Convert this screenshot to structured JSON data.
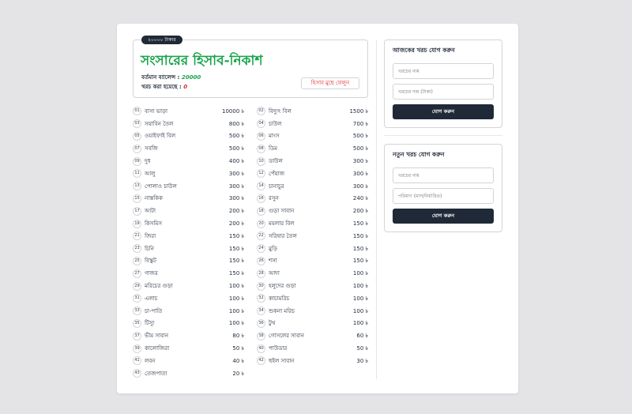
{
  "budget_pill": "২০০০০ টাকার",
  "title": "সংসারের হিসাব-নিকাশ",
  "current_balance_label": "বর্তমান ব্যালেন্স : ",
  "current_balance_value": "20000",
  "spent_label": "খরচ করা হয়েছে : ",
  "spent_value": "0",
  "clear_button": "হিসাব মুছে ফেলুন",
  "items": [
    {
      "no": "01",
      "name": "বাসা ভাড়া",
      "amount": "10000 ৳"
    },
    {
      "no": "02",
      "name": "বিদ্যুৎ বিল",
      "amount": "1500 ৳"
    },
    {
      "no": "03",
      "name": "সয়াবিন তৈল",
      "amount": "800 ৳"
    },
    {
      "no": "04",
      "name": "চাউল",
      "amount": "700 ৳"
    },
    {
      "no": "05",
      "name": "ওয়াইফাই বিল",
      "amount": "500 ৳"
    },
    {
      "no": "06",
      "name": "মাংস",
      "amount": "500 ৳"
    },
    {
      "no": "07",
      "name": "সবজি",
      "amount": "500 ৳"
    },
    {
      "no": "08",
      "name": "ডিম",
      "amount": "500 ৳"
    },
    {
      "no": "09",
      "name": "দুধ",
      "amount": "400 ৳"
    },
    {
      "no": "10",
      "name": "ডাউল",
      "amount": "300 ৳"
    },
    {
      "no": "11",
      "name": "আলু",
      "amount": "300 ৳"
    },
    {
      "no": "12",
      "name": "পেঁয়াজ",
      "amount": "300 ৳"
    },
    {
      "no": "13",
      "name": "পোলাও চাউল",
      "amount": "300 ৳"
    },
    {
      "no": "14",
      "name": "চানাচুর",
      "amount": "300 ৳"
    },
    {
      "no": "15",
      "name": "নাস্তকিক",
      "amount": "300 ৳"
    },
    {
      "no": "16",
      "name": "রসুন",
      "amount": "240 ৳"
    },
    {
      "no": "17",
      "name": "আটা",
      "amount": "200 ৳"
    },
    {
      "no": "18",
      "name": "গুড়া সাবান",
      "amount": "200 ৳"
    },
    {
      "no": "19",
      "name": "কিসমিস",
      "amount": "200 ৳"
    },
    {
      "no": "20",
      "name": "ময়লার বিল",
      "amount": "150 ৳"
    },
    {
      "no": "21",
      "name": "জিরা",
      "amount": "150 ৳"
    },
    {
      "no": "22",
      "name": "সরিষার তৈল",
      "amount": "150 ৳"
    },
    {
      "no": "23",
      "name": "চিনি",
      "amount": "150 ৳"
    },
    {
      "no": "24",
      "name": "মুড়ি",
      "amount": "150 ৳"
    },
    {
      "no": "25",
      "name": "বিস্কুট",
      "amount": "150 ৳"
    },
    {
      "no": "26",
      "name": "শসা",
      "amount": "150 ৳"
    },
    {
      "no": "27",
      "name": "গাজর",
      "amount": "150 ৳"
    },
    {
      "no": "28",
      "name": "আদা",
      "amount": "100 ৳"
    },
    {
      "no": "29",
      "name": "মরিচের গুড়া",
      "amount": "100 ৳"
    },
    {
      "no": "30",
      "name": "হলুদের গুড়া",
      "amount": "100 ৳"
    },
    {
      "no": "31",
      "name": "এলাচ",
      "amount": "100 ৳"
    },
    {
      "no": "32",
      "name": "কাচামরিচ",
      "amount": "100 ৳"
    },
    {
      "no": "33",
      "name": "চা-পাতি",
      "amount": "100 ৳"
    },
    {
      "no": "34",
      "name": "শুকনা মরিচ",
      "amount": "100 ৳"
    },
    {
      "no": "35",
      "name": "টিস্যু",
      "amount": "100 ৳"
    },
    {
      "no": "36",
      "name": "টুথ",
      "amount": "100 ৳"
    },
    {
      "no": "37",
      "name": "ভীম সাবান",
      "amount": "80 ৳"
    },
    {
      "no": "38",
      "name": "গোসলের সাবান",
      "amount": "60 ৳"
    },
    {
      "no": "39",
      "name": "কালোজিরা",
      "amount": "50 ৳"
    },
    {
      "no": "40",
      "name": "পাউডার",
      "amount": "50 ৳"
    },
    {
      "no": "41",
      "name": "লবন",
      "amount": "40 ৳"
    },
    {
      "no": "42",
      "name": "হুইল সাবান",
      "amount": "30 ৳"
    },
    {
      "no": "43",
      "name": "তেজপাতা",
      "amount": "20 ৳"
    }
  ],
  "form_today": {
    "title": "আজকের খরচ যোগ করুন",
    "field1_placeholder": "খরচের নাম",
    "field2_placeholder": "খরচের দাম (টাকা)",
    "submit": "যোগ করুন"
  },
  "form_new": {
    "title": "নতুন খরচ যোগ করুন",
    "field1_placeholder": "খরচের নাম",
    "field2_placeholder": "পরিমাণ (মাস/নির্ধারিত)",
    "submit": "যোগ করুন"
  }
}
